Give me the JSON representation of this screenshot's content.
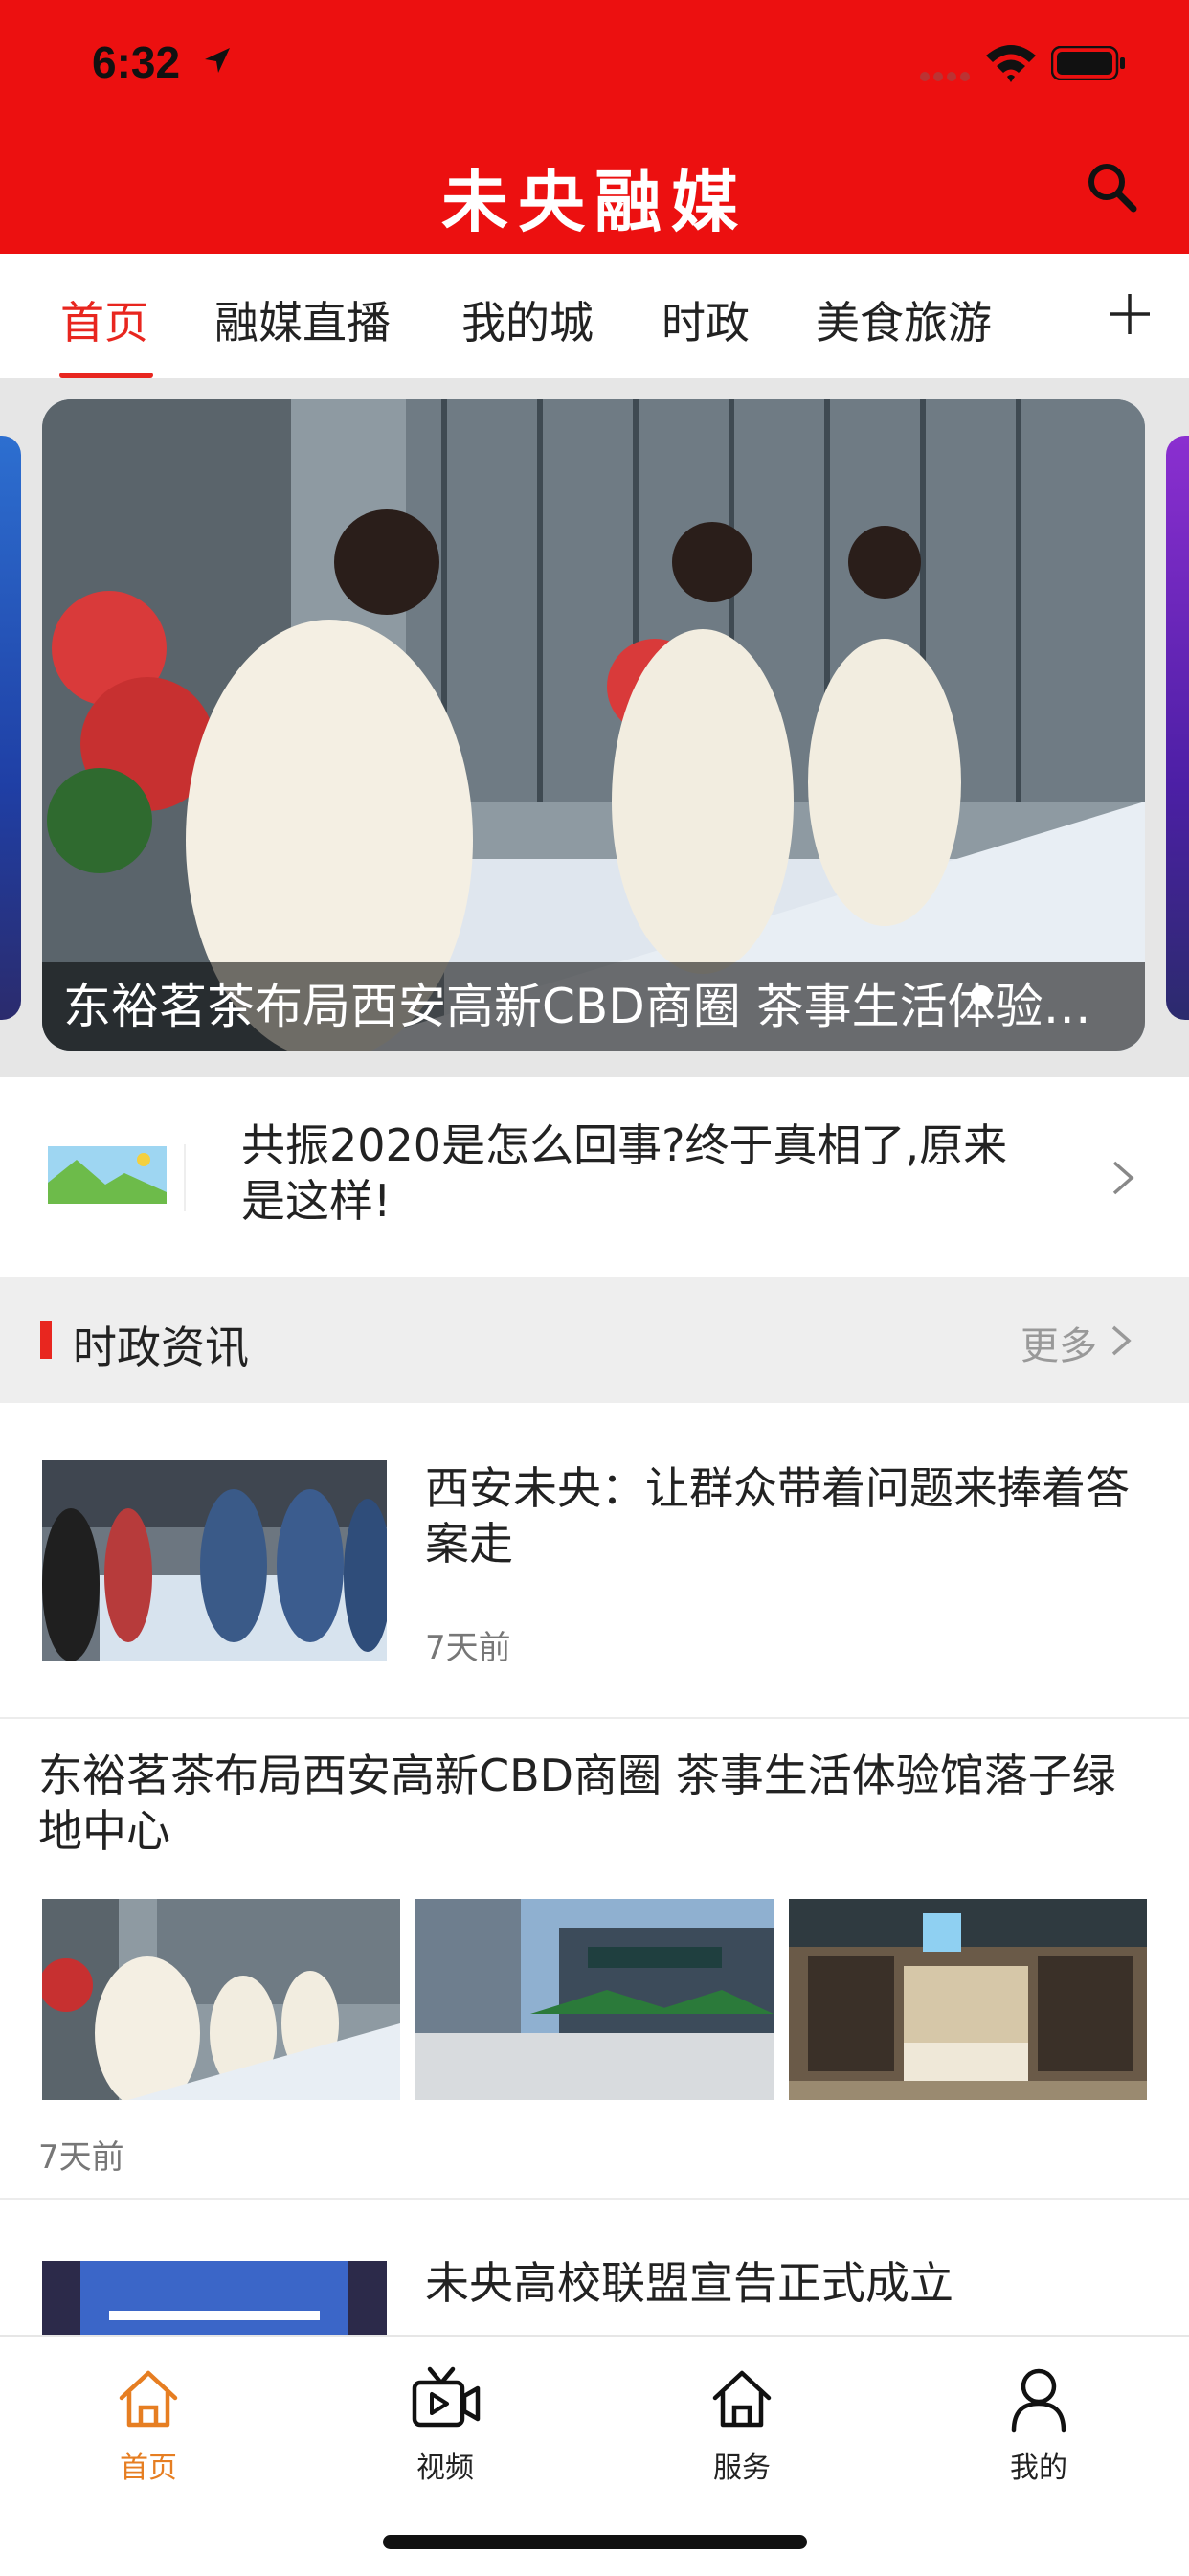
{
  "status_bar": {
    "time": "6:32"
  },
  "header": {
    "title": "未央融媒"
  },
  "tabs": [
    {
      "label": "首页",
      "active": true
    },
    {
      "label": "融媒直播",
      "active": false
    },
    {
      "label": "我的城",
      "active": false
    },
    {
      "label": "时政",
      "active": false
    },
    {
      "label": "美食旅游",
      "active": false
    }
  ],
  "banner": {
    "caption": "东裕茗茶布局西安高新CBD商圈 茶事生活体验馆落子绿地中心"
  },
  "notice": {
    "text": "共振2020是怎么回事?终于真相了,原来是这样!"
  },
  "section": {
    "title": "时政资讯",
    "more_label": "更多"
  },
  "articles": [
    {
      "title": "西安未央：让群众带着问题来捧着答案走",
      "time": "7天前"
    },
    {
      "title": "东裕茗茶布局西安高新CBD商圈 茶事生活体验馆落子绿地中心",
      "time": "7天前"
    },
    {
      "title": "未央高校联盟宣告正式成立"
    }
  ],
  "tabbar": [
    {
      "label": "首页",
      "icon": "home-icon",
      "active": true
    },
    {
      "label": "视频",
      "icon": "video-icon",
      "active": false
    },
    {
      "label": "服务",
      "icon": "service-home-icon",
      "active": false
    },
    {
      "label": "我的",
      "icon": "profile-icon",
      "active": false
    }
  ],
  "colors": {
    "brand_red": "#ec1010",
    "active_tab": "#e8261f",
    "active_tabbar": "#e67e22"
  }
}
